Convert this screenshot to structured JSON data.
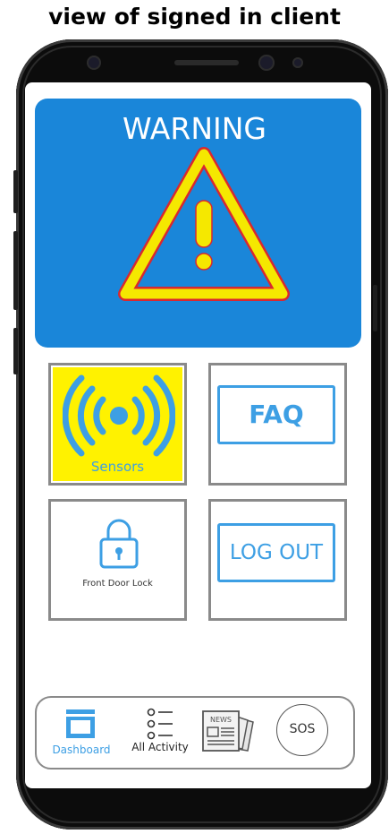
{
  "caption": "view of signed in client",
  "warning": {
    "title": "WARNING"
  },
  "tiles": {
    "sensors_label": "Sensors",
    "faq_label": "FAQ",
    "front_door_label": "Front Door Lock",
    "logout_label": "LOG OUT"
  },
  "navbar": {
    "dashboard_label": "Dashboard",
    "activity_label": "All Activity",
    "news_label": "NEWS",
    "sos_label": "SOS"
  },
  "colors": {
    "accent_blue": "#1a86d9",
    "button_blue": "#3d9fe4",
    "warning_yellow": "#f5e800",
    "sensor_bg": "#fff200"
  },
  "icons": [
    "warning-triangle-icon",
    "wireless-sensor-icon",
    "padlock-icon",
    "dashboard-icon",
    "checklist-icon",
    "newspaper-icon"
  ]
}
